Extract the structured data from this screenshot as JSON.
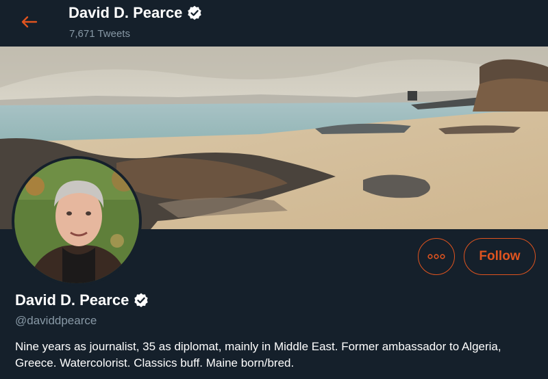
{
  "header": {
    "name": "David D. Pearce",
    "tweet_count": "7,671 Tweets"
  },
  "profile": {
    "name": "David D. Pearce",
    "handle": "@daviddpearce",
    "bio": "Nine years as journalist, 35 as diplomat, mainly in Middle East. Former ambassador to Algeria, Greece. Watercolorist. Classics buff. Maine born/bred.",
    "verified": true
  },
  "actions": {
    "follow_label": "Follow",
    "more_icon": "more-horizontal-icon"
  },
  "icons": {
    "back": "arrow-left-icon",
    "verified": "verified-badge-icon"
  },
  "colors": {
    "background": "#15202b",
    "accent": "#e0541f",
    "secondary_text": "#8899a6"
  }
}
